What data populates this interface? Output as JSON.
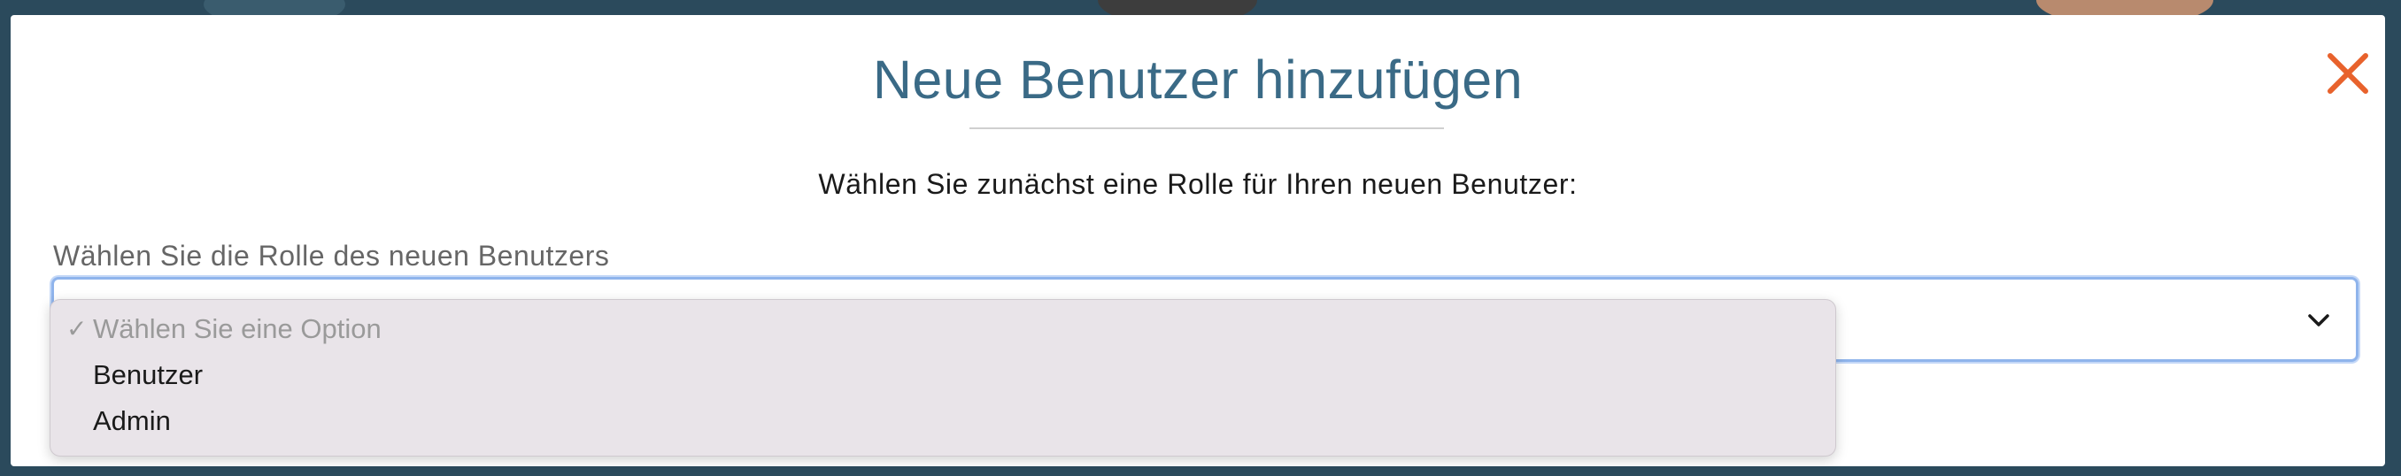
{
  "modal": {
    "title": "Neue Benutzer hinzufügen",
    "instruction": "Wählen Sie zunächst eine Rolle für Ihren neuen Benutzer:",
    "close_icon": "close-icon",
    "accent_color": "#e8622c",
    "title_color": "#3a6a86"
  },
  "role_select": {
    "label": "Wählen Sie die Rolle des neuen Benutzers",
    "selected": "Wählen Sie eine Option",
    "chevron_icon": "chevron-down-icon",
    "options": [
      {
        "label": "Wählen Sie eine Option",
        "selected": true,
        "disabled": true
      },
      {
        "label": "Benutzer",
        "selected": false,
        "disabled": false
      },
      {
        "label": "Admin",
        "selected": false,
        "disabled": false
      }
    ],
    "check_mark": "✓"
  }
}
